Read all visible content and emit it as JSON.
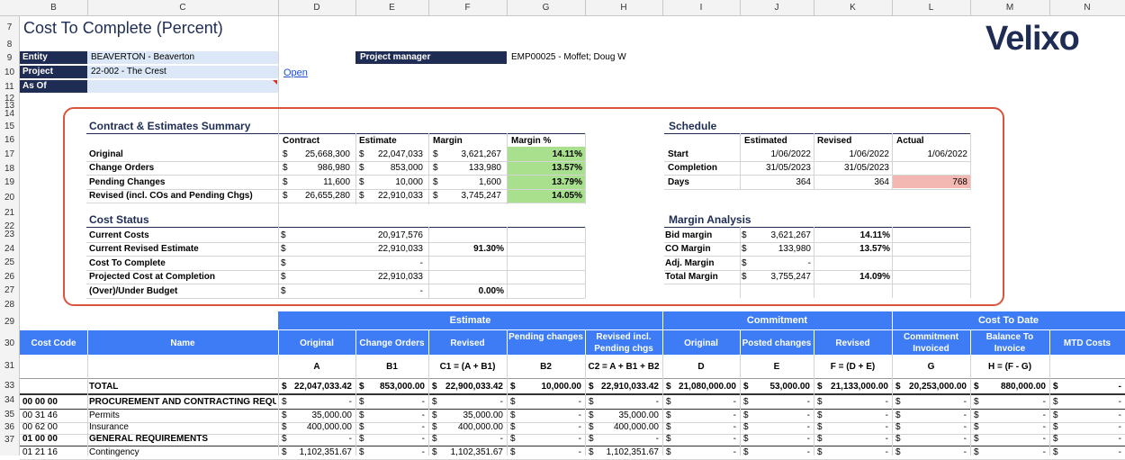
{
  "col_headers": [
    "B",
    "C",
    "D",
    "E",
    "F",
    "G",
    "H",
    "I",
    "J",
    "K",
    "L",
    "M",
    "N"
  ],
  "row_headers": [
    "7",
    "8",
    "9",
    "10",
    "11",
    "12",
    "13",
    "14",
    "15",
    "16",
    "17",
    "18",
    "19",
    "20",
    "21",
    "22",
    "23",
    "24",
    "25",
    "26",
    "27",
    "28",
    "29",
    "30",
    "31",
    "33",
    "34",
    "35",
    "36",
    "37"
  ],
  "title": "Cost To Complete (Percent)",
  "logo": "Velixo",
  "params": {
    "entity_label": "Entity",
    "entity_value": "BEAVERTON - Beaverton",
    "project_label": "Project",
    "project_value": "22-002 - The Crest",
    "asof_label": "As Of",
    "asof_value": "",
    "open_link": "Open",
    "pm_label": "Project manager",
    "pm_value": "EMP00025 - Moffet; Doug W"
  },
  "contract_summary": {
    "title": "Contract & Estimates Summary",
    "headers": [
      "Contract",
      "Estimate",
      "Margin",
      "Margin %"
    ],
    "rows": [
      {
        "label": "Original",
        "contract": "25,668,300",
        "estimate": "22,047,033",
        "margin": "3,621,267",
        "pct": "14.11%"
      },
      {
        "label": "Change Orders",
        "contract": "986,980",
        "estimate": "853,000",
        "margin": "133,980",
        "pct": "13.57%"
      },
      {
        "label": "Pending Changes",
        "contract": "11,600",
        "estimate": "10,000",
        "margin": "1,600",
        "pct": "13.79%"
      },
      {
        "label": "Revised (incl. COs and Pending Chgs)",
        "contract": "26,655,280",
        "estimate": "22,910,033",
        "margin": "3,745,247",
        "pct": "14.05%"
      }
    ]
  },
  "cost_status": {
    "title": "Cost Status",
    "rows": [
      {
        "label": "Current Costs",
        "value": "20,917,576",
        "pct": ""
      },
      {
        "label": "Current Revised Estimate",
        "value": "22,910,033",
        "pct": "91.30%"
      },
      {
        "label": "Cost To Complete",
        "value": "-",
        "pct": ""
      },
      {
        "label": "Projected Cost at Completion",
        "value": "22,910,033",
        "pct": ""
      },
      {
        "label": "(Over)/Under Budget",
        "value": "-",
        "pct": "0.00%"
      }
    ]
  },
  "schedule": {
    "title": "Schedule",
    "headers": [
      "Estimated",
      "Revised",
      "Actual"
    ],
    "rows": [
      {
        "label": "Start",
        "est": "1/06/2022",
        "rev": "1/06/2022",
        "act": "1/06/2022"
      },
      {
        "label": "Completion",
        "est": "31/05/2023",
        "rev": "31/05/2023",
        "act": ""
      },
      {
        "label": "Days",
        "est": "364",
        "rev": "364",
        "act": "768"
      }
    ]
  },
  "margin_analysis": {
    "title": "Margin Analysis",
    "rows": [
      {
        "label": "Bid margin",
        "value": "3,621,267",
        "pct": "14.11%"
      },
      {
        "label": "CO Margin",
        "value": "133,980",
        "pct": "13.57%"
      },
      {
        "label": "Adj. Margin",
        "value": "-",
        "pct": ""
      },
      {
        "label": "Total Margin",
        "value": "3,755,247",
        "pct": "14.09%"
      }
    ]
  },
  "grid": {
    "groups": [
      "Estimate",
      "Commitment",
      "Cost To Date"
    ],
    "headers": [
      "Cost Code",
      "Name",
      "Original",
      "Change Orders",
      "Revised",
      "Pending changes",
      "Revised incl. Pending chgs",
      "Original",
      "Posted changes",
      "Revised",
      "Commitment Invoiced",
      "Balance To Invoice",
      "MTD Costs"
    ],
    "formulas": [
      "A",
      "B1",
      "C1 = (A + B1)",
      "B2",
      "C2 = A + B1 + B2",
      "D",
      "E",
      "F = (D + E)",
      "G",
      "H = (F - G)"
    ],
    "total": {
      "label": "TOTAL",
      "vals": [
        "22,047,033.42",
        "853,000.00",
        "22,900,033.42",
        "10,000.00",
        "22,910,033.42",
        "21,080,000.00",
        "53,000.00",
        "21,133,000.00",
        "20,253,000.00",
        "880,000.00",
        "-"
      ]
    },
    "rows": [
      {
        "code": "00 00 00",
        "name": "PROCUREMENT AND CONTRACTING REQUI",
        "bold": true,
        "vals": [
          "-",
          "-",
          "-",
          "-",
          "-",
          "-",
          "-",
          "-",
          "-",
          "-",
          "-"
        ]
      },
      {
        "code": "00 31 46",
        "name": "Permits",
        "bold": false,
        "vals": [
          "35,000.00",
          "-",
          "35,000.00",
          "-",
          "35,000.00",
          "-",
          "-",
          "-",
          "-",
          "-",
          "-"
        ]
      },
      {
        "code": "00 62 00",
        "name": "Insurance",
        "bold": false,
        "vals": [
          "400,000.00",
          "-",
          "400,000.00",
          "-",
          "400,000.00",
          "-",
          "-",
          "-",
          "-",
          "-",
          "-"
        ]
      },
      {
        "code": "01 00 00",
        "name": "GENERAL REQUIREMENTS",
        "bold": true,
        "vals": [
          "-",
          "-",
          "-",
          "-",
          "-",
          "-",
          "-",
          "-",
          "-",
          "-",
          "-"
        ]
      },
      {
        "code": "01 21 16",
        "name": "Contingency",
        "bold": false,
        "vals": [
          "1,102,351.67",
          "-",
          "1,102,351.67",
          "-",
          "1,102,351.67",
          "-",
          "-",
          "-",
          "-",
          "-",
          "-"
        ]
      }
    ],
    "currency": "$"
  },
  "colors": {
    "navy": "#1f2d54",
    "blue": "#3d7cf5",
    "green": "#a9e08d",
    "pink": "#f4b8b2",
    "input": "#dce8f7",
    "highlight_border": "#d9533d"
  }
}
